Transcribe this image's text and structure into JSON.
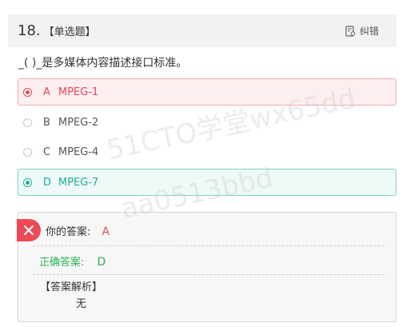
{
  "question": {
    "number": "18.",
    "type": "【单选题】",
    "report_label": "纠错",
    "stem": "_( )_是多媒体内容描述接口标准。"
  },
  "options": [
    {
      "letter": "A",
      "text": "MPEG-1",
      "state": "wrong"
    },
    {
      "letter": "B",
      "text": "MPEG-2",
      "state": "normal"
    },
    {
      "letter": "C",
      "text": "MPEG-4",
      "state": "normal"
    },
    {
      "letter": "D",
      "text": "MPEG-7",
      "state": "correct"
    }
  ],
  "watermarks": [
    "51CTO学堂wx65dd",
    "aa0513bbd"
  ],
  "answer": {
    "my_label": "你的答案:",
    "my_value": "A",
    "correct_label": "正确答案:",
    "correct_value": "D",
    "analysis_title": "【答案解析】",
    "analysis_body": "无"
  },
  "colors": {
    "wrong": "#e04a5a",
    "correct": "#1fae9a",
    "correct_text": "#2fb35a",
    "badge": "#ef4957"
  }
}
